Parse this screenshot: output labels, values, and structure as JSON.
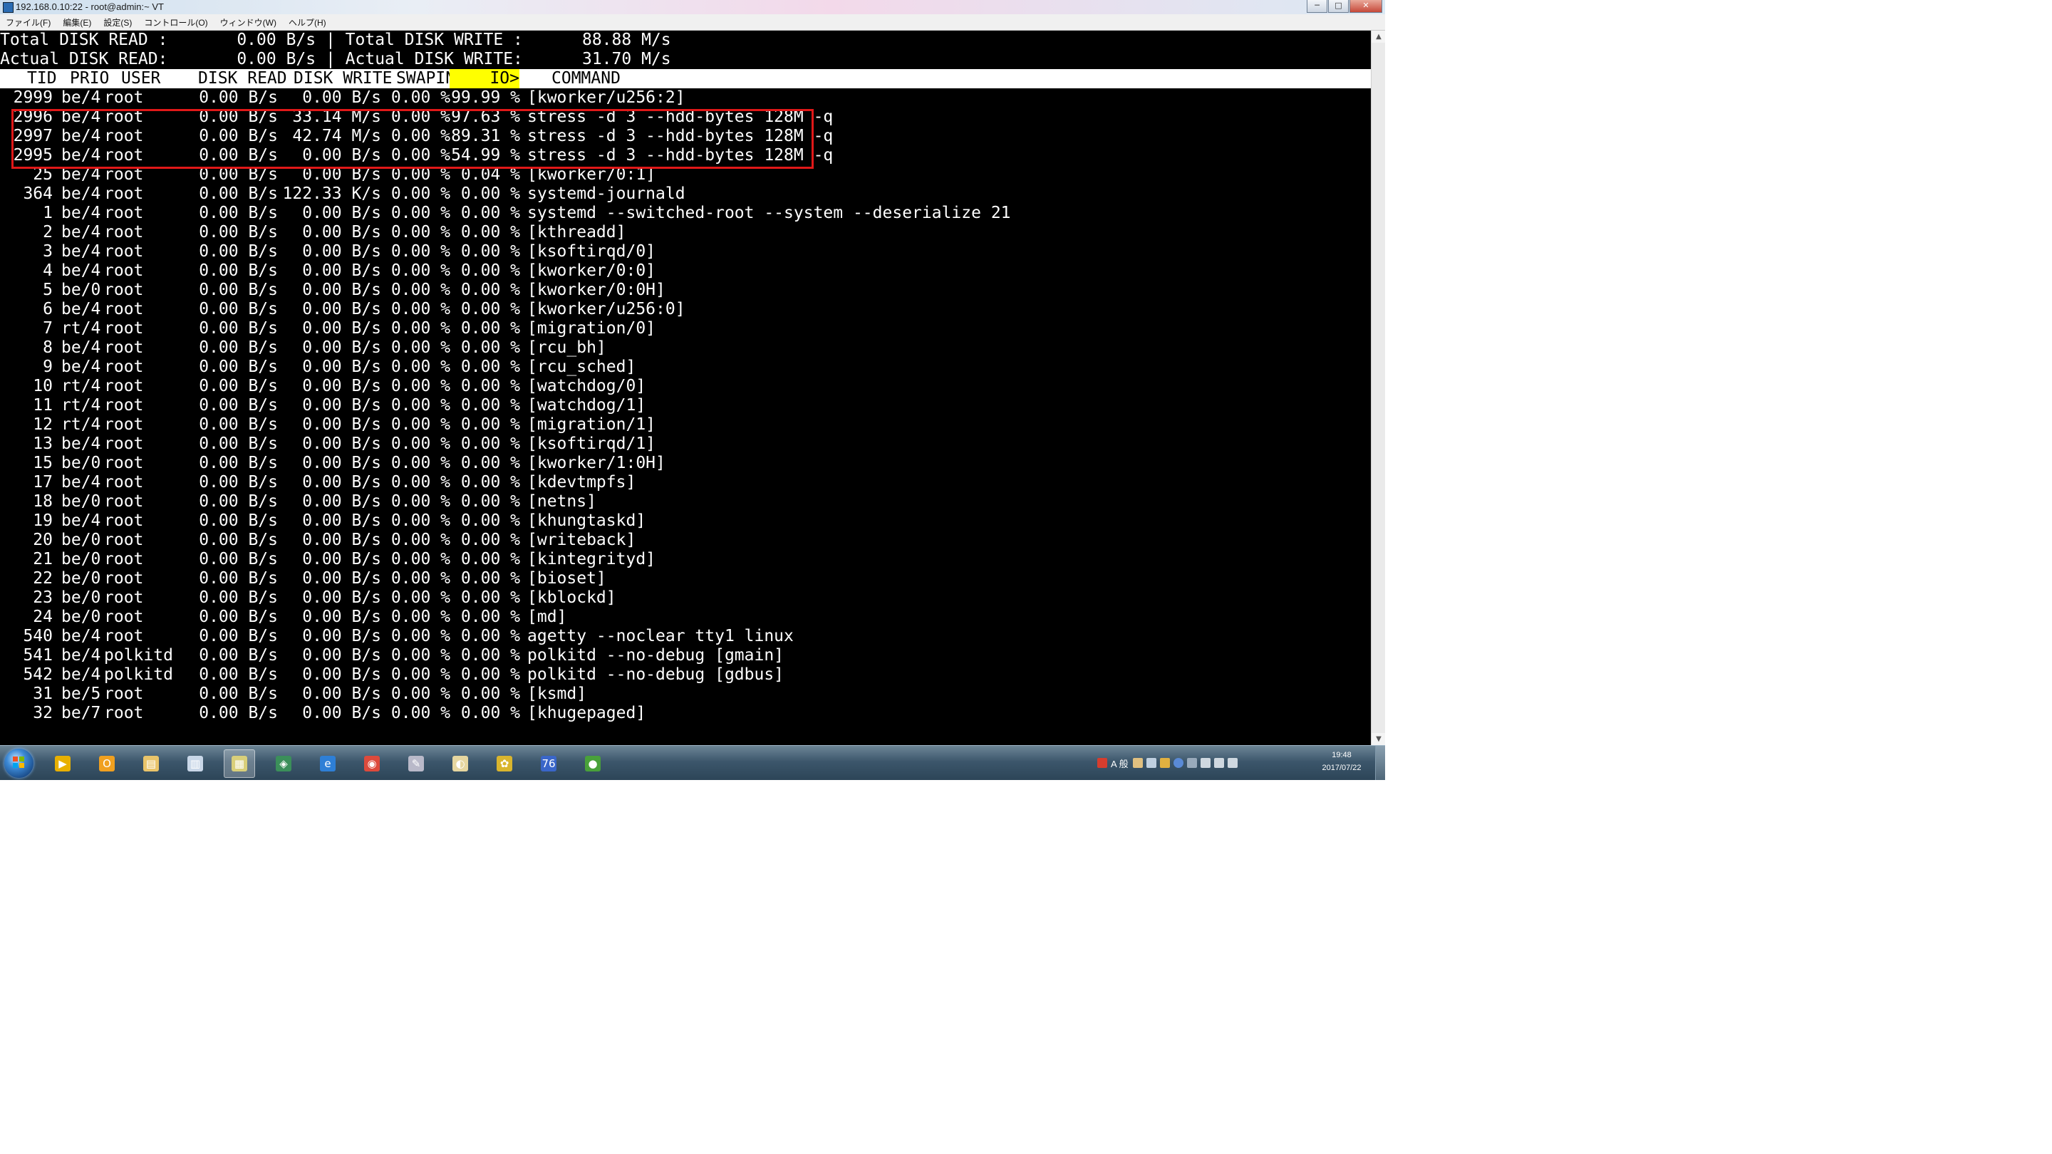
{
  "window": {
    "title": "192.168.0.10:22 - root@admin:~ VT",
    "buttons": {
      "minimize": "─",
      "maximize": "□",
      "close": "✕"
    }
  },
  "menu": [
    "ファイル(F)",
    "編集(E)",
    "設定(S)",
    "コントロール(O)",
    "ウィンドウ(W)",
    "ヘルプ(H)"
  ],
  "summary": [
    "Total DISK READ :       0.00 B/s | Total DISK WRITE :      88.88 M/s",
    "Actual DISK READ:       0.00 B/s | Actual DISK WRITE:      31.70 M/s"
  ],
  "header": {
    "tid": "TID",
    "prio": "PRIO",
    "user": "USER",
    "disk_read": "DISK READ",
    "disk_write": "DISK WRITE",
    "swapin": "SWAPIN",
    "io": "IO>",
    "command": "COMMAND"
  },
  "processes": [
    {
      "tid": "2999",
      "prio": "be/4",
      "user": "root",
      "read": "0.00 B/s",
      "write": "0.00 B/s",
      "swapin": "0.00 %",
      "io": "99.99 %",
      "cmd": "[kworker/u256:2]"
    },
    {
      "tid": "2996",
      "prio": "be/4",
      "user": "root",
      "read": "0.00 B/s",
      "write": "33.14 M/s",
      "swapin": "0.00 %",
      "io": "97.63 %",
      "cmd": "stress -d 3 --hdd-bytes 128M -q"
    },
    {
      "tid": "2997",
      "prio": "be/4",
      "user": "root",
      "read": "0.00 B/s",
      "write": "42.74 M/s",
      "swapin": "0.00 %",
      "io": "89.31 %",
      "cmd": "stress -d 3 --hdd-bytes 128M -q"
    },
    {
      "tid": "2995",
      "prio": "be/4",
      "user": "root",
      "read": "0.00 B/s",
      "write": "0.00 B/s",
      "swapin": "0.00 %",
      "io": "54.99 %",
      "cmd": "stress -d 3 --hdd-bytes 128M -q"
    },
    {
      "tid": "25",
      "prio": "be/4",
      "user": "root",
      "read": "0.00 B/s",
      "write": "0.00 B/s",
      "swapin": "0.00 %",
      "io": "0.04 %",
      "cmd": "[kworker/0:1]"
    },
    {
      "tid": "364",
      "prio": "be/4",
      "user": "root",
      "read": "0.00 B/s",
      "write": "122.33 K/s",
      "swapin": "0.00 %",
      "io": "0.00 %",
      "cmd": "systemd-journald"
    },
    {
      "tid": "1",
      "prio": "be/4",
      "user": "root",
      "read": "0.00 B/s",
      "write": "0.00 B/s",
      "swapin": "0.00 %",
      "io": "0.00 %",
      "cmd": "systemd --switched-root --system --deserialize 21"
    },
    {
      "tid": "2",
      "prio": "be/4",
      "user": "root",
      "read": "0.00 B/s",
      "write": "0.00 B/s",
      "swapin": "0.00 %",
      "io": "0.00 %",
      "cmd": "[kthreadd]"
    },
    {
      "tid": "3",
      "prio": "be/4",
      "user": "root",
      "read": "0.00 B/s",
      "write": "0.00 B/s",
      "swapin": "0.00 %",
      "io": "0.00 %",
      "cmd": "[ksoftirqd/0]"
    },
    {
      "tid": "4",
      "prio": "be/4",
      "user": "root",
      "read": "0.00 B/s",
      "write": "0.00 B/s",
      "swapin": "0.00 %",
      "io": "0.00 %",
      "cmd": "[kworker/0:0]"
    },
    {
      "tid": "5",
      "prio": "be/0",
      "user": "root",
      "read": "0.00 B/s",
      "write": "0.00 B/s",
      "swapin": "0.00 %",
      "io": "0.00 %",
      "cmd": "[kworker/0:0H]"
    },
    {
      "tid": "6",
      "prio": "be/4",
      "user": "root",
      "read": "0.00 B/s",
      "write": "0.00 B/s",
      "swapin": "0.00 %",
      "io": "0.00 %",
      "cmd": "[kworker/u256:0]"
    },
    {
      "tid": "7",
      "prio": "rt/4",
      "user": "root",
      "read": "0.00 B/s",
      "write": "0.00 B/s",
      "swapin": "0.00 %",
      "io": "0.00 %",
      "cmd": "[migration/0]"
    },
    {
      "tid": "8",
      "prio": "be/4",
      "user": "root",
      "read": "0.00 B/s",
      "write": "0.00 B/s",
      "swapin": "0.00 %",
      "io": "0.00 %",
      "cmd": "[rcu_bh]"
    },
    {
      "tid": "9",
      "prio": "be/4",
      "user": "root",
      "read": "0.00 B/s",
      "write": "0.00 B/s",
      "swapin": "0.00 %",
      "io": "0.00 %",
      "cmd": "[rcu_sched]"
    },
    {
      "tid": "10",
      "prio": "rt/4",
      "user": "root",
      "read": "0.00 B/s",
      "write": "0.00 B/s",
      "swapin": "0.00 %",
      "io": "0.00 %",
      "cmd": "[watchdog/0]"
    },
    {
      "tid": "11",
      "prio": "rt/4",
      "user": "root",
      "read": "0.00 B/s",
      "write": "0.00 B/s",
      "swapin": "0.00 %",
      "io": "0.00 %",
      "cmd": "[watchdog/1]"
    },
    {
      "tid": "12",
      "prio": "rt/4",
      "user": "root",
      "read": "0.00 B/s",
      "write": "0.00 B/s",
      "swapin": "0.00 %",
      "io": "0.00 %",
      "cmd": "[migration/1]"
    },
    {
      "tid": "13",
      "prio": "be/4",
      "user": "root",
      "read": "0.00 B/s",
      "write": "0.00 B/s",
      "swapin": "0.00 %",
      "io": "0.00 %",
      "cmd": "[ksoftirqd/1]"
    },
    {
      "tid": "15",
      "prio": "be/0",
      "user": "root",
      "read": "0.00 B/s",
      "write": "0.00 B/s",
      "swapin": "0.00 %",
      "io": "0.00 %",
      "cmd": "[kworker/1:0H]"
    },
    {
      "tid": "17",
      "prio": "be/4",
      "user": "root",
      "read": "0.00 B/s",
      "write": "0.00 B/s",
      "swapin": "0.00 %",
      "io": "0.00 %",
      "cmd": "[kdevtmpfs]"
    },
    {
      "tid": "18",
      "prio": "be/0",
      "user": "root",
      "read": "0.00 B/s",
      "write": "0.00 B/s",
      "swapin": "0.00 %",
      "io": "0.00 %",
      "cmd": "[netns]"
    },
    {
      "tid": "19",
      "prio": "be/4",
      "user": "root",
      "read": "0.00 B/s",
      "write": "0.00 B/s",
      "swapin": "0.00 %",
      "io": "0.00 %",
      "cmd": "[khungtaskd]"
    },
    {
      "tid": "20",
      "prio": "be/0",
      "user": "root",
      "read": "0.00 B/s",
      "write": "0.00 B/s",
      "swapin": "0.00 %",
      "io": "0.00 %",
      "cmd": "[writeback]"
    },
    {
      "tid": "21",
      "prio": "be/0",
      "user": "root",
      "read": "0.00 B/s",
      "write": "0.00 B/s",
      "swapin": "0.00 %",
      "io": "0.00 %",
      "cmd": "[kintegrityd]"
    },
    {
      "tid": "22",
      "prio": "be/0",
      "user": "root",
      "read": "0.00 B/s",
      "write": "0.00 B/s",
      "swapin": "0.00 %",
      "io": "0.00 %",
      "cmd": "[bioset]"
    },
    {
      "tid": "23",
      "prio": "be/0",
      "user": "root",
      "read": "0.00 B/s",
      "write": "0.00 B/s",
      "swapin": "0.00 %",
      "io": "0.00 %",
      "cmd": "[kblockd]"
    },
    {
      "tid": "24",
      "prio": "be/0",
      "user": "root",
      "read": "0.00 B/s",
      "write": "0.00 B/s",
      "swapin": "0.00 %",
      "io": "0.00 %",
      "cmd": "[md]"
    },
    {
      "tid": "540",
      "prio": "be/4",
      "user": "root",
      "read": "0.00 B/s",
      "write": "0.00 B/s",
      "swapin": "0.00 %",
      "io": "0.00 %",
      "cmd": "agetty --noclear tty1 linux"
    },
    {
      "tid": "541",
      "prio": "be/4",
      "user": "polkitd",
      "read": "0.00 B/s",
      "write": "0.00 B/s",
      "swapin": "0.00 %",
      "io": "0.00 %",
      "cmd": "polkitd --no-debug [gmain]"
    },
    {
      "tid": "542",
      "prio": "be/4",
      "user": "polkitd",
      "read": "0.00 B/s",
      "write": "0.00 B/s",
      "swapin": "0.00 %",
      "io": "0.00 %",
      "cmd": "polkitd --no-debug [gdbus]"
    },
    {
      "tid": "31",
      "prio": "be/5",
      "user": "root",
      "read": "0.00 B/s",
      "write": "0.00 B/s",
      "swapin": "0.00 %",
      "io": "0.00 %",
      "cmd": "[ksmd]"
    },
    {
      "tid": "32",
      "prio": "be/7",
      "user": "root",
      "read": "0.00 B/s",
      "write": "0.00 B/s",
      "swapin": "0.00 %",
      "io": "0.00 %",
      "cmd": "[khugepaged]"
    }
  ],
  "colors": {
    "highlight_border": "#e01818",
    "io_sort_bg": "#ffff00",
    "terminal_bg": "#000000",
    "terminal_fg": "#ffffff"
  },
  "taskbar": {
    "icons": [
      {
        "name": "media-player-icon",
        "color": "#e8b000",
        "glyph": "▶"
      },
      {
        "name": "outlook-icon",
        "color": "#f0a020",
        "glyph": "O"
      },
      {
        "name": "explorer-folder-icon",
        "color": "#e9c46a",
        "glyph": "▤"
      },
      {
        "name": "document-icon",
        "color": "#c9d7e8",
        "glyph": "▥"
      },
      {
        "name": "teraterm-icon",
        "color": "#d9cf7a",
        "glyph": "▦"
      },
      {
        "name": "network-icon",
        "color": "#3b8f5a",
        "glyph": "◈"
      },
      {
        "name": "internet-explorer-icon",
        "color": "#2e7fd6",
        "glyph": "e"
      },
      {
        "name": "chrome-icon",
        "color": "#dd4a3c",
        "glyph": "◉"
      },
      {
        "name": "tool-icon",
        "color": "#b9b9c9",
        "glyph": "✎"
      },
      {
        "name": "paint-icon",
        "color": "#e6d6a0",
        "glyph": "◐"
      },
      {
        "name": "puzzle-icon",
        "color": "#d9b52e",
        "glyph": "✿"
      },
      {
        "name": "app-76-icon",
        "color": "#3a66c9",
        "glyph": "76"
      },
      {
        "name": "green-app-icon",
        "color": "#49a13a",
        "glyph": "●"
      }
    ],
    "ime_label": "A 般",
    "clock_time": "19:48",
    "clock_date": "2017/07/22"
  }
}
